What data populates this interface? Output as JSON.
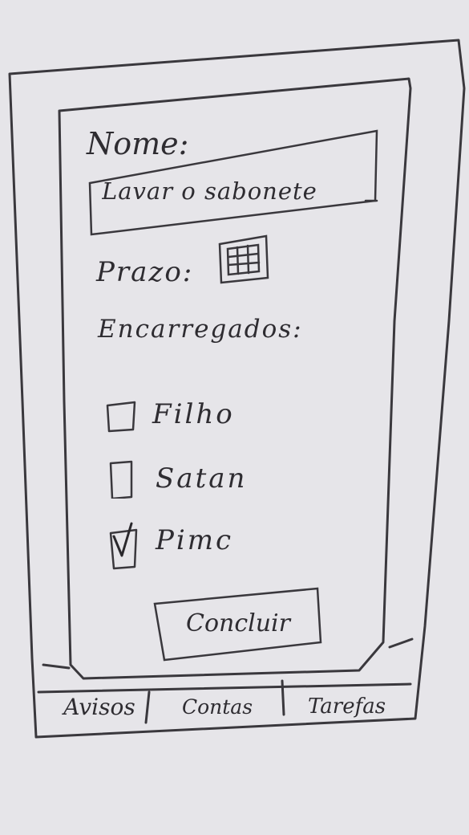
{
  "form": {
    "name_label": "Nome:",
    "name_value": "Lavar o sabonete",
    "deadline_label": "Prazo:",
    "assignees_label": "Encarregados:",
    "assignees": [
      {
        "label": "Filho",
        "checked": false
      },
      {
        "label": "Satan",
        "checked": false
      },
      {
        "label": "Pimc",
        "checked": true
      }
    ],
    "submit_label": "Concluir"
  },
  "tabs": [
    {
      "label": "Avisos"
    },
    {
      "label": "Contas"
    },
    {
      "label": "Tarefas",
      "active": true
    }
  ],
  "icons": {
    "calendar": "calendar-icon",
    "checkmark": "checkmark-icon"
  },
  "colors": {
    "paper": "#e6e5e9",
    "ink": "#2e2c31"
  }
}
